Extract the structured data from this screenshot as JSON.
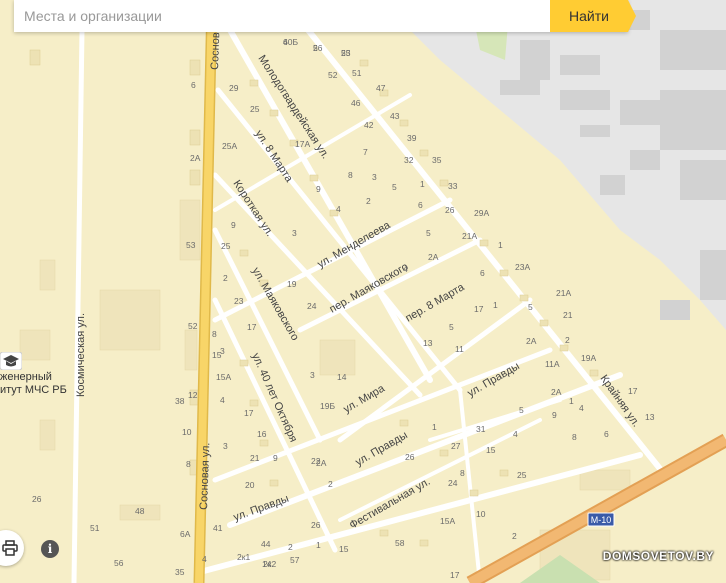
{
  "search": {
    "placeholder": "Места и организации",
    "button_label": "Найти"
  },
  "poi": {
    "name_line1": "женерный",
    "name_line2": "итут МЧС РБ"
  },
  "streets": {
    "sosnovaya_top": "Сосновая ул.",
    "sosnovaya_bottom": "Сосновая ул.",
    "kosmicheskaya": "Космическая ул.",
    "molodogvardeyskaya": "Молодогвардейская ул.",
    "march8_a": "ул. 8 Марта",
    "march8_b": "пер. 8 Марта",
    "korotkaya": "Короткая ул.",
    "mendeleeva": "ул. Менделеева",
    "mayakovskogo": "ул. Маяковского",
    "mayakovskogo_per": "пер. Маяковского",
    "let40": "ул. 40 лет Октября",
    "mira": "ул. Мира",
    "pravdy_a": "ул. Правды",
    "pravdy_b": "ул. Правды",
    "pravdy_c": "ул. Правды",
    "festivalnaya": "Фестивальная ул.",
    "krainyaya": "Крайняя ул."
  },
  "road_badge": "М-10",
  "watermark": "DOMSOVETOV.BY",
  "house_numbers": [
    "60Б",
    "56",
    "53",
    "52",
    "51",
    "47",
    "46",
    "43",
    "42",
    "39",
    "35",
    "33",
    "32",
    "29",
    "25",
    "17А",
    "25А",
    "7",
    "8",
    "3",
    "5",
    "1",
    "9",
    "2",
    "6",
    "26",
    "29А",
    "5",
    "4",
    "3",
    "9",
    "1",
    "25",
    "23А",
    "21А",
    "21А",
    "2А",
    "6",
    "4",
    "5",
    "2",
    "19",
    "24",
    "23",
    "21",
    "17",
    "2",
    "3",
    "5",
    "1",
    "17",
    "13",
    "11",
    "2А",
    "8",
    "15",
    "14",
    "3",
    "19А",
    "19Б",
    "15А",
    "4",
    "11А",
    "17",
    "17",
    "13",
    "2А",
    "5",
    "9",
    "1",
    "4",
    "6",
    "8",
    "4",
    "16",
    "3",
    "2А",
    "1",
    "27",
    "31",
    "15",
    "24",
    "21",
    "9",
    "8",
    "20",
    "2",
    "26",
    "22",
    "25",
    "38",
    "26",
    "15",
    "15А",
    "10",
    "41",
    "44",
    "2",
    "1",
    "56",
    "51",
    "48",
    "35",
    "2к1",
    "2к2",
    "2А",
    "53",
    "52",
    "12",
    "10",
    "8",
    "6",
    "6А",
    "4",
    "14",
    "2",
    "57",
    "58",
    "17",
    "26",
    "4",
    "2",
    "25"
  ],
  "colors": {
    "road_main": "#f8d568",
    "road_edge": "#e0b94a",
    "street": "#ffffff",
    "background": "#f6eec8",
    "industrial": "#e6e6e6",
    "building": "#ede2b4"
  },
  "icons": {
    "print": "printer-icon",
    "info": "info-icon",
    "poi": "school-icon"
  }
}
